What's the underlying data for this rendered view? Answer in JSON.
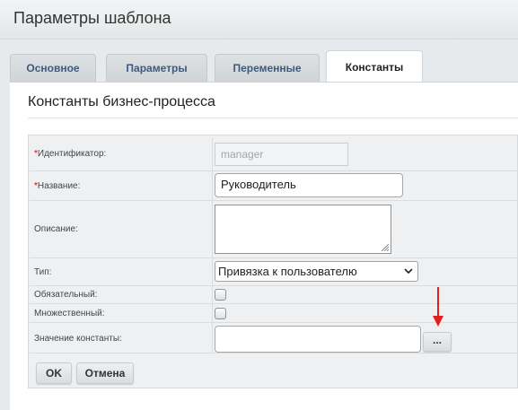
{
  "window": {
    "title": "Параметры шаблона"
  },
  "tabs": [
    {
      "label": "Основное",
      "active": false
    },
    {
      "label": "Параметры",
      "active": false
    },
    {
      "label": "Переменные",
      "active": false
    },
    {
      "label": "Константы",
      "active": true
    }
  ],
  "section": {
    "title": "Константы бизнес-процесса"
  },
  "form": {
    "required_mark": "*",
    "identifier": {
      "label": "Идентификатор:",
      "value": "manager",
      "required": true,
      "disabled": true
    },
    "name": {
      "label": "Название:",
      "value": "Руководитель",
      "required": true
    },
    "description": {
      "label": "Описание:",
      "value": ""
    },
    "type": {
      "label": "Тип:",
      "selected": "Привязка к пользователю"
    },
    "mandatory": {
      "label": "Обязательный:",
      "checked": false
    },
    "multiple": {
      "label": "Множественный:",
      "checked": false
    },
    "constant_value": {
      "label": "Значение константы:",
      "value": "",
      "picker_label": "..."
    }
  },
  "buttons": {
    "ok": "OK",
    "cancel": "Отмена"
  },
  "colors": {
    "required_mark": "#cc0000",
    "annotation_arrow": "#e02020",
    "tab_text": "#3e5a7a"
  },
  "annotation": {
    "arrow_icon": "down-arrow-icon"
  }
}
